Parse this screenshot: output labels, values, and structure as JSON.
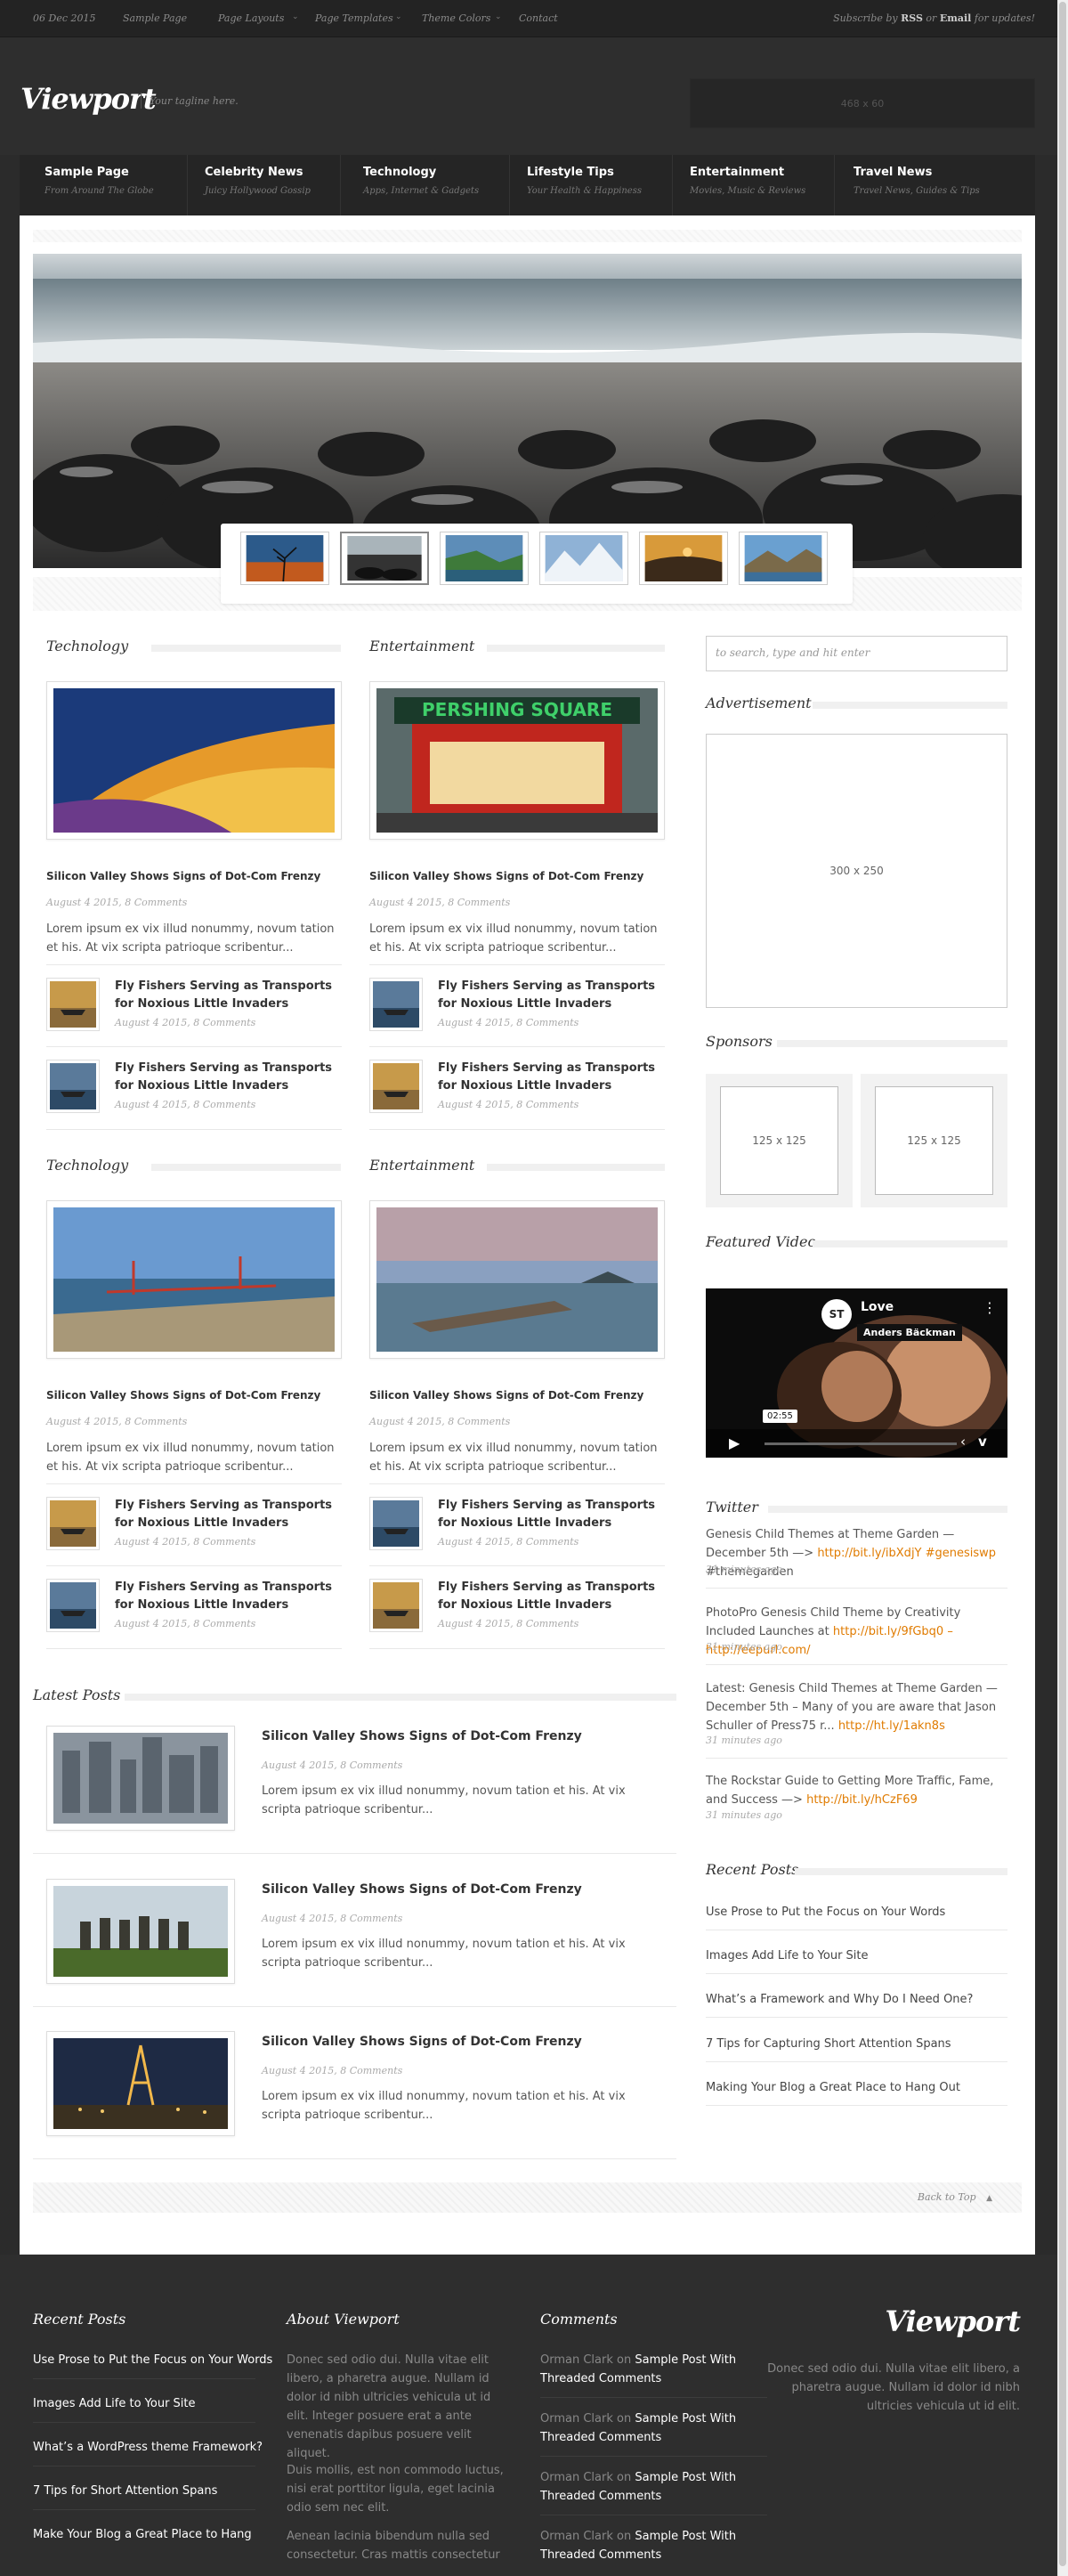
{
  "topbar": {
    "date": "06 Dec 2015",
    "menu": [
      "Sample Page",
      "Page Layouts",
      "Page Templates",
      "Theme Colors",
      "Contact"
    ],
    "subscribe_pre": "Subscribe by",
    "rss": "RSS",
    "or": "or",
    "email": "Email",
    "subscribe_post": "for updates!"
  },
  "header": {
    "logo": "Viewport",
    "tagline": "Your tagline here.",
    "ad": "468 x 60"
  },
  "nav": [
    {
      "label": "Sample Page",
      "sub": "From Around The Globe"
    },
    {
      "label": "Celebrity News",
      "sub": "Juicy Hollywood Gossip"
    },
    {
      "label": "Technology",
      "sub": "Apps, Internet & Gadgets"
    },
    {
      "label": "Lifestyle Tips",
      "sub": "Your Health & Happiness"
    },
    {
      "label": "Entertainment",
      "sub": "Movies, Music & Reviews"
    },
    {
      "label": "Travel News",
      "sub": "Travel News, Guides & Tips"
    }
  ],
  "sections": [
    {
      "title": "Technology",
      "headline": "Silicon Valley Shows Signs of Dot-Com Frenzy",
      "meta": "August 4 2015, 8 Comments",
      "excerpt": "Lorem ipsum ex vix illud nonummy, novum tation et his. At vix scripta patrioque scribentur...",
      "items": [
        {
          "title": "Fly Fishers Serving as Transports for Noxious Little Invaders",
          "meta": "August 4 2015, 8 Comments"
        },
        {
          "title": "Fly Fishers Serving as Transports for Noxious Little Invaders",
          "meta": "August 4 2015, 8 Comments"
        }
      ]
    },
    {
      "title": "Entertainment",
      "headline": "Silicon Valley Shows Signs of Dot-Com Frenzy",
      "meta": "August 4 2015, 8 Comments",
      "excerpt": "Lorem ipsum ex vix illud nonummy, novum tation et his. At vix scripta patrioque scribentur...",
      "items": [
        {
          "title": "Fly Fishers Serving as Transports for Noxious Little Invaders",
          "meta": "August 4 2015, 8 Comments"
        },
        {
          "title": "Fly Fishers Serving as Transports for Noxious Little Invaders",
          "meta": "August 4 2015, 8 Comments"
        }
      ]
    },
    {
      "title": "Technology",
      "headline": "Silicon Valley Shows Signs of Dot-Com Frenzy",
      "meta": "August 4 2015, 8 Comments",
      "excerpt": "Lorem ipsum ex vix illud nonummy, novum tation et his. At vix scripta patrioque scribentur...",
      "items": [
        {
          "title": "Fly Fishers Serving as Transports for Noxious Little Invaders",
          "meta": "August 4 2015, 8 Comments"
        },
        {
          "title": "Fly Fishers Serving as Transports for Noxious Little Invaders",
          "meta": "August 4 2015, 8 Comments"
        }
      ]
    },
    {
      "title": "Entertainment",
      "headline": "Silicon Valley Shows Signs of Dot-Com Frenzy",
      "meta": "August 4 2015, 8 Comments",
      "excerpt": "Lorem ipsum ex vix illud nonummy, novum tation et his. At vix scripta patrioque scribentur...",
      "items": [
        {
          "title": "Fly Fishers Serving as Transports for Noxious Little Invaders",
          "meta": "August 4 2015, 8 Comments"
        },
        {
          "title": "Fly Fishers Serving as Transports for Noxious Little Invaders",
          "meta": "August 4 2015, 8 Comments"
        }
      ]
    }
  ],
  "latest": {
    "title": "Latest Posts",
    "posts": [
      {
        "title": "Silicon Valley Shows Signs of Dot-Com Frenzy",
        "meta": "August 4 2015, 8 Comments",
        "excerpt": "Lorem ipsum ex vix illud nonummy, novum tation et his. At vix scripta patrioque scribentur..."
      },
      {
        "title": "Silicon Valley Shows Signs of Dot-Com Frenzy",
        "meta": "August 4 2015, 8 Comments",
        "excerpt": "Lorem ipsum ex vix illud nonummy, novum tation et his. At vix scripta patrioque scribentur..."
      },
      {
        "title": "Silicon Valley Shows Signs of Dot-Com Frenzy",
        "meta": "August 4 2015, 8 Comments",
        "excerpt": "Lorem ipsum ex vix illud nonummy, novum tation et his. At vix scripta patrioque scribentur..."
      }
    ]
  },
  "sidebar": {
    "search_placeholder": "to search, type and hit enter",
    "ad_title": "Advertisement",
    "ad": "300 x 250",
    "sponsors_title": "Sponsors",
    "sponsors": [
      "125 x 125",
      "125 x 125"
    ],
    "video_title": "Featured Video",
    "video": {
      "title": "Love",
      "author": "Anders Bäckman",
      "time": "02:55",
      "channel": "ST"
    },
    "twitter_title": "Twitter",
    "tweets": [
      {
        "text": "Genesis Child Themes at Theme Garden — December 5th —> ",
        "link": "http://bit.ly/ibXdjY #genesiswp",
        "tail": " #themegarden",
        "time": "31 minutes ago"
      },
      {
        "text": "PhotoPro Genesis Child Theme by Creativity Included Launches at ",
        "link": "http://bit.ly/9fGbq0 – http://eepurl.com/",
        "tail": "",
        "time": "31 minutes ago"
      },
      {
        "text": "Latest: Genesis Child Themes at Theme Garden — December 5th – Many of you are aware that Jason Schuller of Press75 r... ",
        "link": "http://ht.ly/1akn8s",
        "tail": "",
        "time": "31 minutes ago"
      },
      {
        "text": "The Rockstar Guide to Getting More Traffic, Fame, and Success —> ",
        "link": "http://bit.ly/hCzF69",
        "tail": "",
        "time": "31 minutes ago"
      }
    ],
    "recent_title": "Recent Posts",
    "recent": [
      "Use Prose to Put the Focus on Your Words",
      "Images Add Life to Your Site",
      "What’s a Framework and Why Do I Need One?",
      "7 Tips for Capturing Short Attention Spans",
      "Making Your Blog a Great Place to Hang Out"
    ]
  },
  "back_to_top": "Back to Top",
  "footer": {
    "recent_title": "Recent Posts",
    "recent": [
      "Use Prose to Put the Focus on Your Words",
      "Images Add Life to Your Site",
      "What’s a WordPress theme Framework?",
      "7 Tips for Short Attention Spans",
      "Make Your Blog a Great Place to Hang"
    ],
    "about_title": "About Viewport",
    "about": [
      "Donec sed odio dui. Nulla vitae elit libero, a pharetra augue. Nullam id dolor id nibh ultricies vehicula ut id elit. Integer posuere erat a ante venenatis dapibus posuere velit aliquet.",
      "Duis mollis, est non commodo luctus, nisi erat porttitor ligula, eget lacinia odio sem nec elit.",
      "Aenean lacinia bibendum nulla sed consectetur. Cras mattis consectetur"
    ],
    "comments_title": "Comments",
    "comments": [
      {
        "author": "Orman Clark",
        "on": "on",
        "post": "Sample Post With Threaded Comments"
      },
      {
        "author": "Orman Clark",
        "on": "on",
        "post": "Sample Post With Threaded Comments"
      },
      {
        "author": "Orman Clark",
        "on": "on",
        "post": "Sample Post With Threaded Comments"
      },
      {
        "author": "Orman Clark",
        "on": "on",
        "post": "Sample Post With Threaded Comments"
      }
    ],
    "logo": "Viewport",
    "desc": "Donec sed odio dui. Nulla vitae elit libero, a pharetra augue. Nullam id dolor id nibh ultricies vehicula ut id elit."
  },
  "colors": {
    "accent": "#e07b00",
    "dark": "#2b2b2b",
    "topbar": "#232323"
  }
}
